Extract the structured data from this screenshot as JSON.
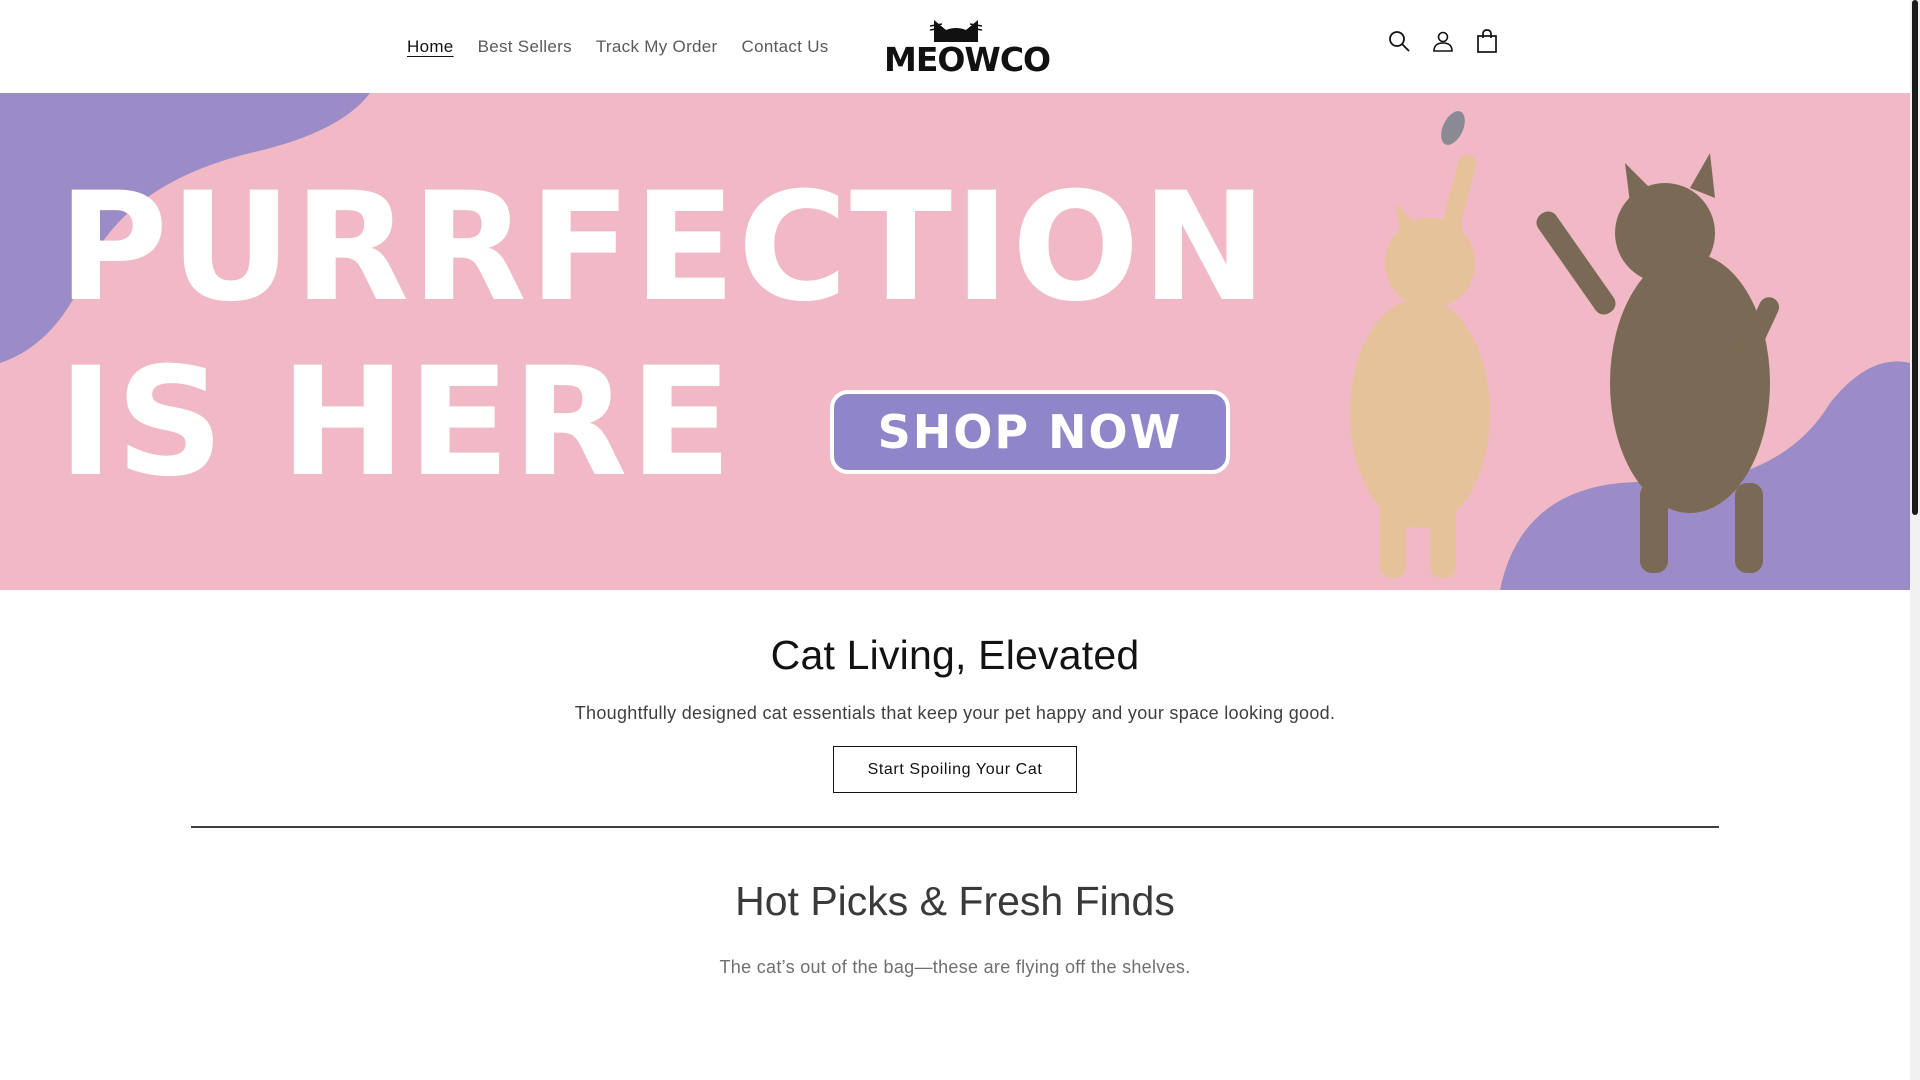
{
  "header": {
    "nav": [
      "Home",
      "Best Sellers",
      "Track My Order",
      "Contact Us"
    ],
    "logo_text": "MEOWCO",
    "icons": [
      "search-icon",
      "account-icon",
      "cart-icon"
    ]
  },
  "hero": {
    "line1": "PURRFECTION",
    "line2": "IS HERE",
    "button": "SHOP NOW"
  },
  "intro": {
    "title": "Cat Living, Elevated",
    "text": "Thoughtfully designed cat essentials that keep your pet happy and your space looking good.",
    "cta": "Start Spoiling Your Cat"
  },
  "picks": {
    "title": "Hot Picks & Fresh Finds",
    "subtitle": "The cat’s out of the bag—these are flying off the shelves."
  },
  "colors": {
    "hero_pink": "#f1b9c5",
    "hero_purple": "#8f86c9",
    "text": "#121212"
  }
}
